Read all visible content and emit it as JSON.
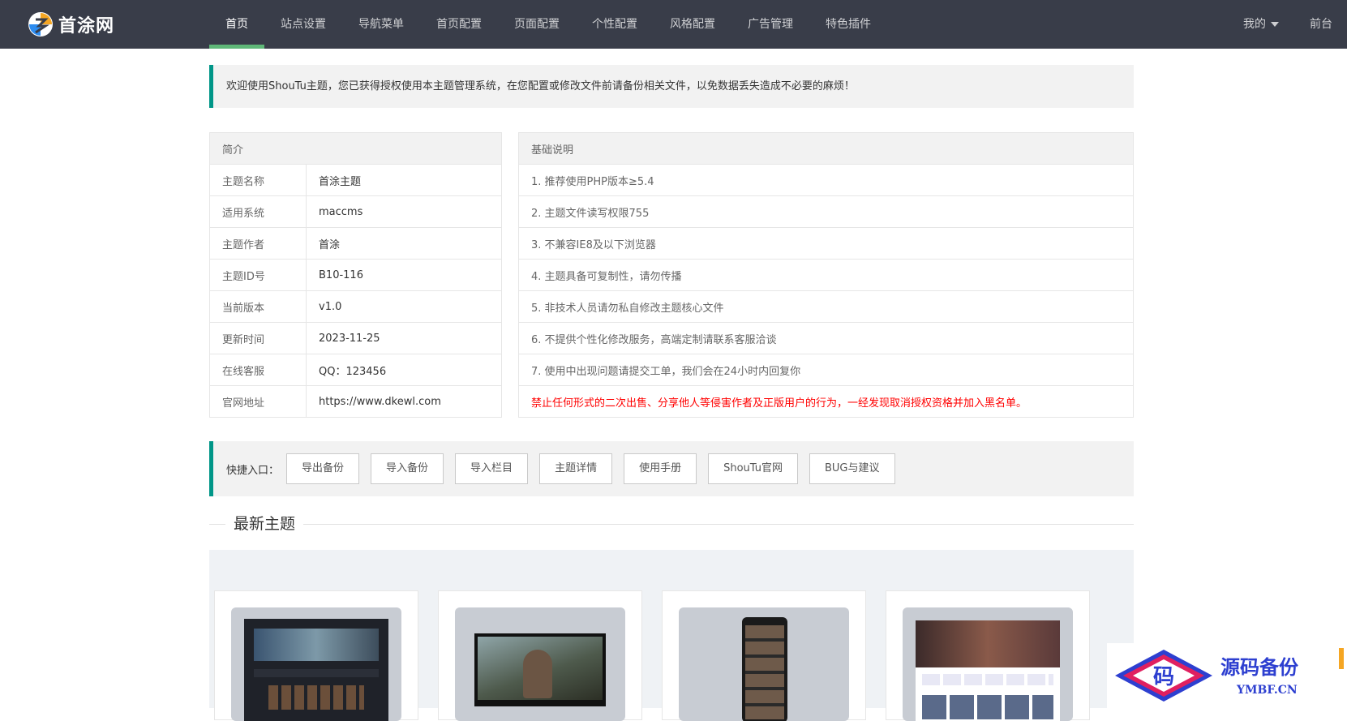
{
  "brand": {
    "name": "首涂网"
  },
  "nav": {
    "items": [
      {
        "label": "首页"
      },
      {
        "label": "站点设置"
      },
      {
        "label": "导航菜单"
      },
      {
        "label": "首页配置"
      },
      {
        "label": "页面配置"
      },
      {
        "label": "个性配置"
      },
      {
        "label": "风格配置"
      },
      {
        "label": "广告管理"
      },
      {
        "label": "特色插件"
      }
    ],
    "active_index": 0,
    "user_menu": "我的",
    "frontend_link": "前台"
  },
  "notice": {
    "text": "欢迎使用ShouTu主题，您已获得授权使用本主题管理系统，在您配置或修改文件前请备份相关文件，以免数据丢失造成不必要的麻烦！"
  },
  "intro": {
    "header": "简介",
    "rows": [
      {
        "key": "主题名称",
        "value": "首涂主题"
      },
      {
        "key": "适用系统",
        "value": "maccms"
      },
      {
        "key": "主题作者",
        "value": "首涂"
      },
      {
        "key": "主题ID号",
        "value": "B10-116"
      },
      {
        "key": "当前版本",
        "value": "v1.0"
      },
      {
        "key": "更新时间",
        "value": "2023-11-25"
      },
      {
        "key": "在线客服",
        "value": "QQ：123456"
      },
      {
        "key": "官网地址",
        "value": "https://www.dkewl.com"
      }
    ]
  },
  "basic": {
    "header": "基础说明",
    "rows": [
      "1. 推荐使用PHP版本≥5.4",
      "2. 主题文件读写权限755",
      "3. 不兼容IE8及以下浏览器",
      "4. 主题具备可复制性，请勿传播",
      "5. 非技术人员请勿私自修改主题核心文件",
      "6. 不提供个性化修改服务，高端定制请联系客服洽谈",
      "7. 使用中出现问题请提交工单，我们会在24小时内回复你"
    ],
    "warning": "禁止任何形式的二次出售、分享他人等侵害作者及正版用户的行为，一经发现取消授权资格并加入黑名单。"
  },
  "quick": {
    "label": "快捷入口：",
    "buttons": [
      "导出备份",
      "导入备份",
      "导入栏目",
      "主题详情",
      "使用手册",
      "ShouTu官网",
      "BUG与建议"
    ]
  },
  "latest": {
    "title": "最新主题"
  },
  "colors": {
    "topbar": "#393d49",
    "accent": "#009688",
    "active_underline": "#5fb878",
    "warning": "#ff0000"
  }
}
